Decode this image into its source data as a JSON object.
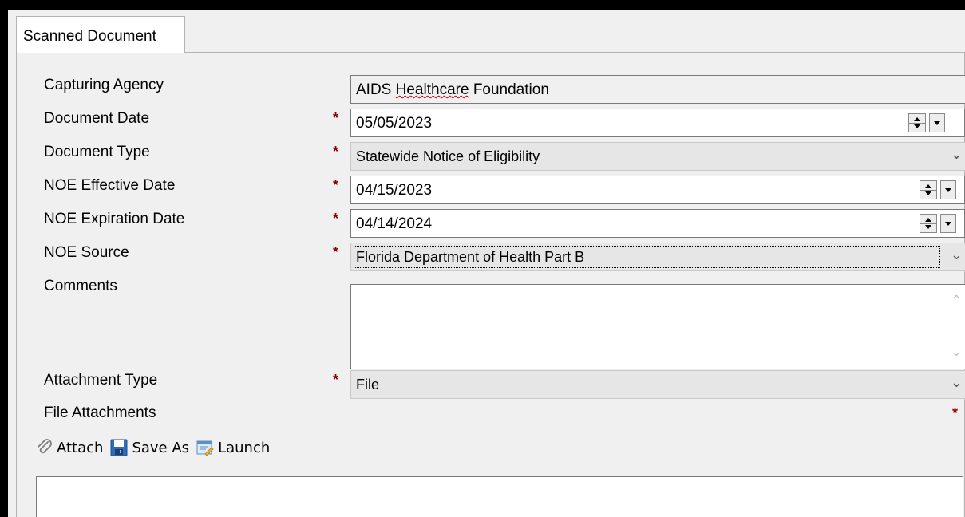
{
  "tab": {
    "label": "Scanned Document"
  },
  "form": {
    "capturing_agency": {
      "label": "Capturing Agency",
      "value": "AIDS Healthcare Foundation"
    },
    "document_date": {
      "label": "Document Date",
      "value": "05/05/2023",
      "required": "*"
    },
    "document_type": {
      "label": "Document Type",
      "value": "Statewide Notice of Eligibility",
      "required": "*"
    },
    "noe_effective_date": {
      "label": "NOE Effective Date",
      "value": "04/15/2023",
      "required": "*"
    },
    "noe_expiration_date": {
      "label": "NOE Expiration Date",
      "value": "04/14/2024",
      "required": "*"
    },
    "noe_source": {
      "label": "NOE Source",
      "value": "Florida Department of Health Part B",
      "required": "*"
    },
    "comments": {
      "label": "Comments",
      "value": ""
    },
    "attachment_type": {
      "label": "Attachment Type",
      "value": "File",
      "required": "*"
    },
    "file_attachments": {
      "label": "File Attachments",
      "required": "*"
    }
  },
  "toolbar": {
    "attach_label": "Attach",
    "save_as_label": "Save As",
    "launch_label": "Launch"
  },
  "colors": {
    "required_star": "#8b0000",
    "window_bg": "#f0f0f0",
    "field_bg": "#ffffff",
    "combo_bg": "#e6e6e6"
  },
  "icons": {
    "attach": "paperclip-icon",
    "save_as": "floppy-disk-icon",
    "launch": "launch-document-icon"
  }
}
